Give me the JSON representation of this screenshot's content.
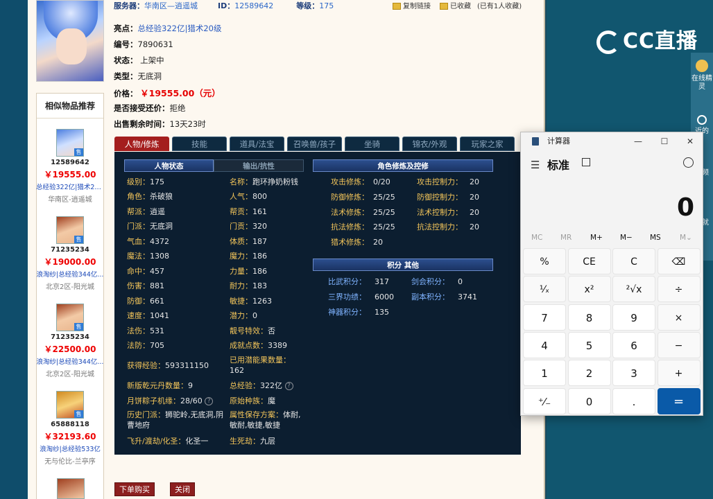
{
  "top": {
    "server_label": "服务器：",
    "server_value": "华南区—逍遥城",
    "id_label": "ID：",
    "id_value": "12589642",
    "level_label": "等级：",
    "level_value": "175",
    "copy_link": "复制链接",
    "favorited": "已收藏",
    "fav_count": "(已有1人收藏)"
  },
  "item": {
    "highlight_label": "亮点：",
    "highlight_value": "总经验322亿|猎术20级",
    "number_label": "编号：",
    "number_value": "7890631",
    "status_label": "状态：",
    "status_value": "上架中",
    "type_label": "类型：",
    "type_value": "无底洞",
    "price_label": "价格：",
    "price_value": "￥19555.00（元）",
    "bargain_label": "是否接受还价：",
    "bargain_value": "拒绝",
    "time_label": "出售剩余时间：",
    "time_value": "13天23时"
  },
  "similar": {
    "title": "相似物品推荐",
    "items": [
      {
        "id": "12589642",
        "price": "￥19555.00",
        "highlight": "总经验322亿|猎术20级",
        "server": "华南区-逍遥城"
      },
      {
        "id": "71235234",
        "price": "￥19000.00",
        "highlight": "浪淘纱|总经验344亿...",
        "server": "北京2区-阳光城"
      },
      {
        "id": "71235234",
        "price": "￥22500.00",
        "highlight": "浪淘纱|总经验344亿...",
        "server": "北京2区-阳光城"
      },
      {
        "id": "65888118",
        "price": "￥32193.60",
        "highlight": "浪淘纱|总经验533亿",
        "server": "无与伦比-兰亭序"
      }
    ],
    "sale_tag": "售"
  },
  "tabs": [
    "人物/修炼",
    "技能",
    "道具/法宝",
    "召唤兽/孩子",
    "坐骑",
    "锦衣/外观",
    "玩家之家"
  ],
  "panel": {
    "sec_status": "人物状态",
    "sec_resist": "输出/抗性",
    "sec_cultivation": "角色修炼及控修",
    "sec_points": "积分 其他",
    "left_col": [
      {
        "k": "级别：",
        "v": "175"
      },
      {
        "k": "角色：",
        "v": "杀破狼"
      },
      {
        "k": "帮派：",
        "v": "逍遥"
      },
      {
        "k": "门派：",
        "v": "无底洞"
      },
      {
        "k": "气血：",
        "v": "4372"
      },
      {
        "k": "魔法：",
        "v": "1308"
      },
      {
        "k": "命中：",
        "v": "457"
      },
      {
        "k": "伤害：",
        "v": "881"
      },
      {
        "k": "防御：",
        "v": "661"
      },
      {
        "k": "速度：",
        "v": "1041"
      },
      {
        "k": "法伤：",
        "v": "531"
      },
      {
        "k": "法防：",
        "v": "705"
      }
    ],
    "mid_col": [
      {
        "k": "名称：",
        "v": "跑环挣奶粉钱"
      },
      {
        "k": "人气：",
        "v": "800"
      },
      {
        "k": "帮贡：",
        "v": "161"
      },
      {
        "k": "门贡：",
        "v": "320"
      },
      {
        "k": "体质：",
        "v": "187"
      },
      {
        "k": "魔力：",
        "v": "186"
      },
      {
        "k": "力量：",
        "v": "186"
      },
      {
        "k": "耐力：",
        "v": "183"
      },
      {
        "k": "敏捷：",
        "v": "1263"
      },
      {
        "k": "潜力：",
        "v": "0"
      },
      {
        "k": "靓号特效：",
        "v": "否"
      },
      {
        "k": "成就点数：",
        "v": "3389"
      }
    ],
    "exp_label": "获得经验：",
    "exp_value": "593311150",
    "fruit_label": "已用潜能果数量：",
    "fruit_value": "162",
    "qiankun_label": "新版乾元丹数量：",
    "qiankun_value": "9",
    "total_exp_label": "总经验：",
    "total_exp_value": "322亿",
    "zongzi_label": "月饼粽子机缘：",
    "zongzi_value": "28/60",
    "race_label": "原始种族：",
    "race_value": "魔",
    "history_label": "历史门派：",
    "history_value": "狮驼岭,无底洞,阴曹地府",
    "attr_label": "属性保存方案：",
    "attr_value": "体耐,敏耐,敏捷,敏捷",
    "ascend_label": "飞升/渡劫/化圣：",
    "ascend_value": "化圣一",
    "life_label": "生死劫：",
    "life_value": "九层",
    "cult": [
      {
        "k": "攻击修炼：",
        "v": "0/20",
        "k2": "攻击控制力：",
        "v2": "20"
      },
      {
        "k": "防御修炼：",
        "v": "25/25",
        "k2": "防御控制力：",
        "v2": "20"
      },
      {
        "k": "法术修炼：",
        "v": "25/25",
        "k2": "法术控制力：",
        "v2": "20"
      },
      {
        "k": "抗法修炼：",
        "v": "25/25",
        "k2": "抗法控制力：",
        "v2": "20"
      },
      {
        "k": "猎术修炼：",
        "v": "20",
        "k2": "",
        "v2": ""
      }
    ],
    "points": [
      {
        "k": "比武积分：",
        "v": "317",
        "k2": "剑会积分：",
        "v2": "0"
      },
      {
        "k": "三界功绩：",
        "v": "6000",
        "k2": "副本积分：",
        "v2": "3741"
      },
      {
        "k": "神器积分：",
        "v": "135",
        "k2": "",
        "v2": ""
      }
    ],
    "help": "?"
  },
  "buttons": {
    "buy": "下单购买",
    "close": "关闭"
  },
  "overlay": {
    "logo_text": "CC直播",
    "dock": [
      "在线精灵",
      "近的",
      "视频",
      "码就"
    ]
  },
  "calculator": {
    "title": "计算器",
    "mode": "标准",
    "display": "0",
    "memory": [
      "MC",
      "MR",
      "M+",
      "M−",
      "MS",
      "M⌄"
    ],
    "keys": [
      "%",
      "CE",
      "C",
      "⌫",
      "¹⁄ₓ",
      "x²",
      "²√x",
      "÷",
      "7",
      "8",
      "9",
      "×",
      "4",
      "5",
      "6",
      "−",
      "1",
      "2",
      "3",
      "+",
      "⁺⁄₋",
      "0",
      ".",
      "="
    ],
    "minimize": "—",
    "maximize": "☐",
    "close": "✕"
  }
}
